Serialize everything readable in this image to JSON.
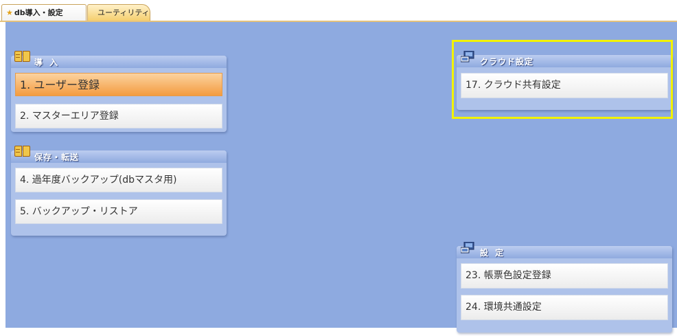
{
  "tabs": [
    {
      "label": "db導入・設定",
      "icon": "star-icon",
      "active": true
    },
    {
      "label": "ユーティリティ",
      "active": false
    }
  ],
  "panels": {
    "intro": {
      "title": "導 入",
      "icon": "book-icon",
      "items": [
        {
          "label": "1. ユーザー登録",
          "selected": true
        },
        {
          "label": "2. マスターエリア登録"
        }
      ]
    },
    "save": {
      "title": "保存・転送",
      "icon": "book-icon",
      "items": [
        {
          "label": "4. 過年度バックアップ(dbマスタ用)"
        },
        {
          "label": "5. バックアップ・リストア"
        }
      ]
    },
    "cloud": {
      "title": "クラウド設定",
      "icon": "computer-icon",
      "items": [
        {
          "label": "17. クラウド共有設定"
        }
      ]
    },
    "settings": {
      "title": "設 定",
      "icon": "computer-icon",
      "items": [
        {
          "label": "23. 帳票色設定登録"
        },
        {
          "label": "24. 環境共通設定"
        }
      ]
    }
  },
  "colors": {
    "background": "#8eaae0",
    "panel": "#aec2ea",
    "selected_item": "#f49b3f",
    "highlight": "#f2f200"
  }
}
